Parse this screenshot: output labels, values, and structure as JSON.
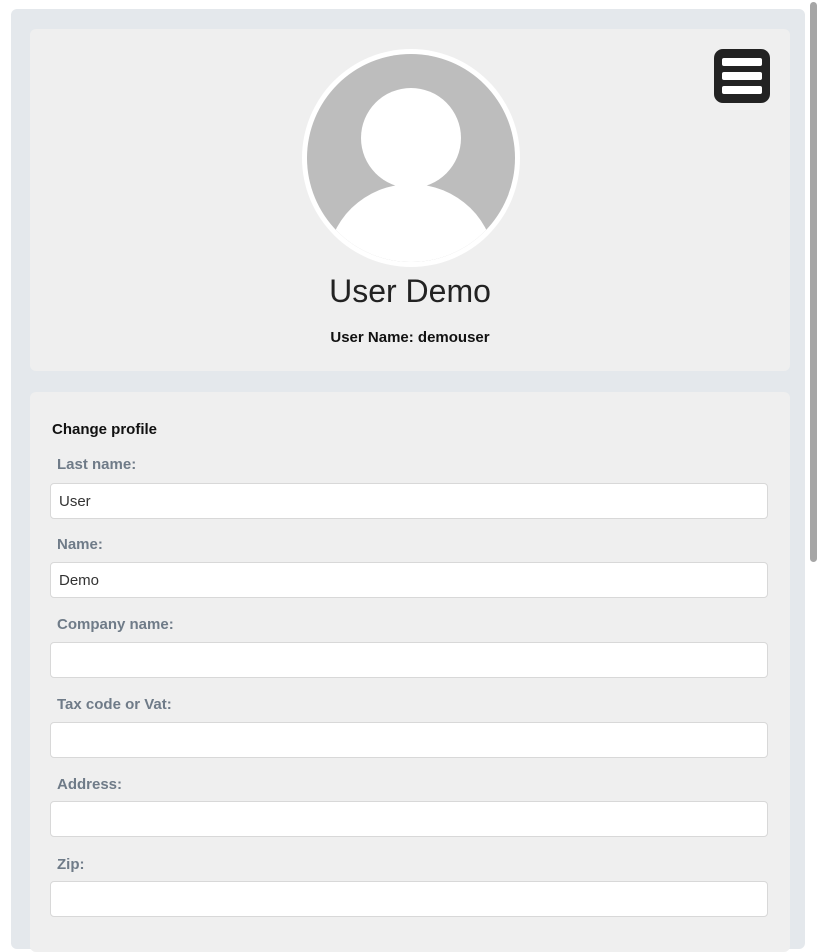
{
  "profile": {
    "full_name": "User Demo",
    "username_line": "User Name: demouser",
    "avatar_icon": "user-silhouette-icon",
    "menu_icon": "hamburger-menu-icon"
  },
  "form": {
    "title": "Change profile",
    "fields": [
      {
        "label": "Last name:",
        "value": "User",
        "placeholder": ""
      },
      {
        "label": "Name:",
        "value": "Demo",
        "placeholder": ""
      },
      {
        "label": "Company name:",
        "value": "",
        "placeholder": ""
      },
      {
        "label": "Tax code or Vat:",
        "value": "",
        "placeholder": ""
      },
      {
        "label": "Address:",
        "value": "",
        "placeholder": ""
      },
      {
        "label": "Zip:",
        "value": "",
        "placeholder": ""
      }
    ]
  },
  "colors": {
    "frame": "#e4e8ec",
    "card": "#efefef",
    "label": "#6f7b88",
    "avatar_gray": "#bdbdbd",
    "menu_dark": "#222222"
  }
}
